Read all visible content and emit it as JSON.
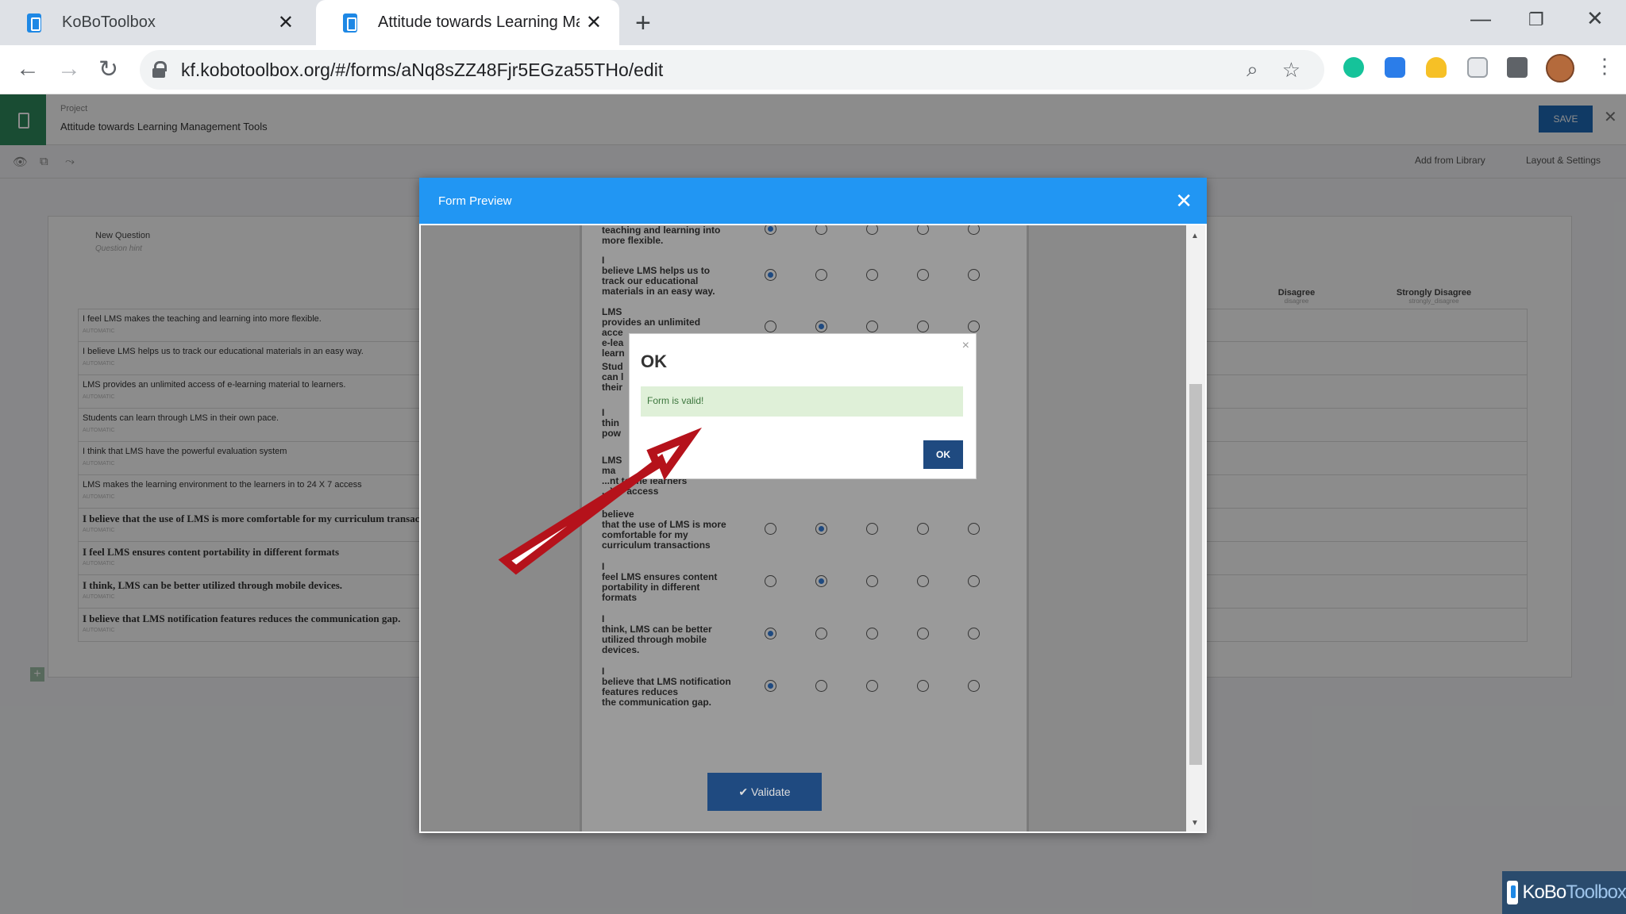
{
  "browser": {
    "tabs": [
      {
        "title": "KoBoToolbox",
        "active": false
      },
      {
        "title": "Attitude towards Learning Manag",
        "active": true
      }
    ],
    "url": "kf.kobotoolbox.org/#/forms/aNq8sZZ48Fjr5EGza55THo/edit"
  },
  "app": {
    "project_label": "Project",
    "project_name": "Attitude towards Learning Management Tools",
    "save_label": "SAVE",
    "add_from_library": "Add from Library",
    "layout_settings": "Layout & Settings",
    "new_question": "New Question",
    "question_hint": "Question hint",
    "column_headers": [
      {
        "label": "Disagree",
        "value": "disagree"
      },
      {
        "label": "Strongly Disagree",
        "value": "strongly_disagree"
      }
    ],
    "auto_tag": "AUTOMATIC",
    "rows": [
      "I feel LMS makes the teaching  and learning into more flexible.",
      "I believe LMS helps us to track our educational materials in an easy way.",
      "LMS provides an unlimited access of    e-learning material to learners.",
      "Students can learn through LMS in their own pace.",
      "I think that LMS have the powerful evaluation system",
      "LMS makes the learning environment to the learners in to 24 X 7 access",
      "I believe that the use of LMS is more comfortable for my curriculum transactions",
      "I feel LMS ensures content portability in different formats",
      "I think, LMS can be better utilized through mobile devices.",
      "I believe that LMS notification features reduces  the  communication gap."
    ]
  },
  "preview": {
    "title": "Form Preview",
    "questions": [
      {
        "lines": [
          "teaching  and learning into",
          "more flexible."
        ],
        "selected": 0
      },
      {
        "lines": [
          "I",
          "believe LMS helps us to",
          "track our educational",
          "materials in an easy way."
        ],
        "selected": 0
      },
      {
        "lines": [
          "LMS",
          "provides an unlimited",
          "acce",
          "e-lea",
          "learn"
        ],
        "selected": 1
      },
      {
        "lines": [
          "Stud",
          "can l",
          "their"
        ],
        "selected": -1
      },
      {
        "lines": [
          "I",
          "thin",
          "pow"
        ],
        "selected": -1
      },
      {
        "lines": [
          "LMS",
          "ma",
          "...nt to the learners",
          "...X 7 access"
        ],
        "selected": -1
      },
      {
        "lines": [
          "believe",
          "that the use of LMS is more",
          "comfortable for my",
          "curriculum transactions"
        ],
        "selected": 1
      },
      {
        "lines": [
          "I",
          "feel LMS ensures content",
          "portability in different",
          "formats"
        ],
        "selected": 1
      },
      {
        "lines": [
          "I",
          "think, LMS can be better",
          "utilized through mobile",
          "devices."
        ],
        "selected": 0
      },
      {
        "lines": [
          "I",
          "believe that LMS notification",
          "features reduces",
          "the  communication gap."
        ],
        "selected": 0
      }
    ],
    "validate_label": "✔ Validate"
  },
  "dialog": {
    "title": "OK",
    "message": "Form is valid!",
    "button": "OK"
  },
  "watermark": {
    "part1": "KoBo",
    "part2": "Toolbox"
  },
  "colors": {
    "accent": "#2196f3",
    "primary_dark": "#1f4a80",
    "success_bg": "#dff0d8",
    "success_text": "#3c763d",
    "arrow": "#b5121b"
  }
}
